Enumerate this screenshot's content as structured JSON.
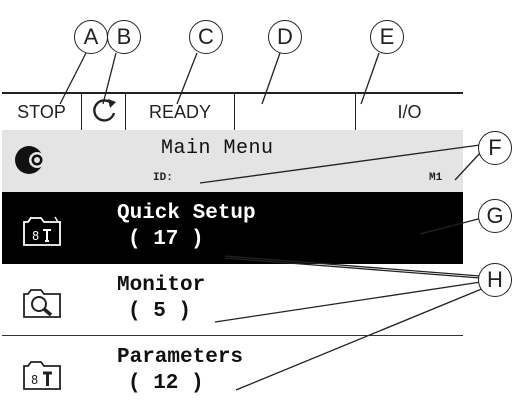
{
  "callouts": [
    "A",
    "B",
    "C",
    "D",
    "E",
    "F",
    "G",
    "H"
  ],
  "status_bar": {
    "state": "STOP",
    "direction_icon": "rotation-direction-icon",
    "status": "READY",
    "alarm": "",
    "control_place": "I/O"
  },
  "header": {
    "logo_icon": "vacon-logo-icon",
    "title": "Main Menu",
    "id_label": "ID:",
    "location": "M1"
  },
  "menu_items": [
    {
      "title": "Quick Setup",
      "count": "( 17 )",
      "icon": "quick-setup-folder-icon",
      "selected": true
    },
    {
      "title": "Monitor",
      "count": "( 5 )",
      "icon": "monitor-folder-icon",
      "selected": false
    },
    {
      "title": "Parameters",
      "count": "( 12 )",
      "icon": "parameters-folder-icon",
      "selected": false
    }
  ],
  "colors": {
    "selected_bg": "#000000",
    "header_bg": "#e4e4e4",
    "line": "#222222"
  }
}
